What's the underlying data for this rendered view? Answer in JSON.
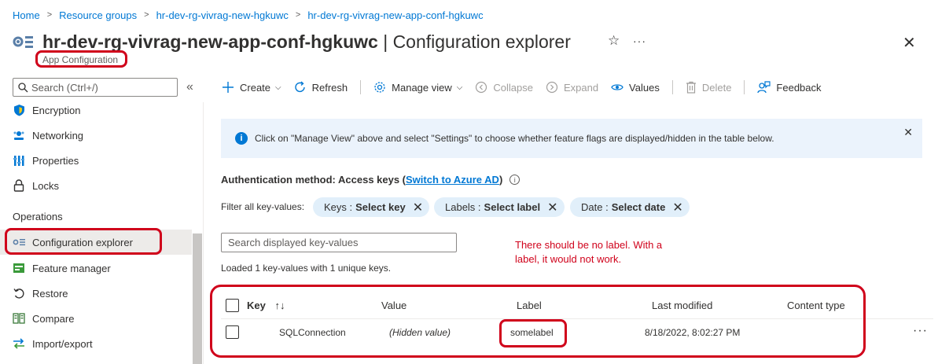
{
  "breadcrumb": [
    "Home",
    "Resource groups",
    "hr-dev-rg-vivrag-new-hgkuwc",
    "hr-dev-rg-vivrag-new-app-conf-hgkuwc"
  ],
  "header": {
    "resource_name": "hr-dev-rg-vivrag-new-app-conf-hgkuwc",
    "page_title": " | Configuration explorer",
    "subtitle": "App Configuration",
    "more": "···",
    "close": "✕",
    "star": "☆"
  },
  "sidebar": {
    "search_placeholder": "Search (Ctrl+/)",
    "collapse": "«",
    "items": [
      {
        "label": "Encryption",
        "icon": "shield-icon"
      },
      {
        "label": "Networking",
        "icon": "network-icon"
      },
      {
        "label": "Properties",
        "icon": "properties-icon"
      },
      {
        "label": "Locks",
        "icon": "lock-icon"
      }
    ],
    "section": "Operations",
    "operations": [
      {
        "label": "Configuration explorer",
        "icon": "config-explorer-icon",
        "active": true
      },
      {
        "label": "Feature manager",
        "icon": "feature-manager-icon"
      },
      {
        "label": "Restore",
        "icon": "restore-icon"
      },
      {
        "label": "Compare",
        "icon": "compare-icon"
      },
      {
        "label": "Import/export",
        "icon": "import-export-icon"
      }
    ]
  },
  "toolbar": {
    "create": "Create",
    "refresh": "Refresh",
    "manage_view": "Manage view",
    "collapse": "Collapse",
    "expand": "Expand",
    "values": "Values",
    "delete": "Delete",
    "feedback": "Feedback"
  },
  "banner": {
    "text": "Click on \"Manage View\" above and select \"Settings\" to choose whether feature flags are displayed/hidden in the table below."
  },
  "auth": {
    "label": "Authentication method: Access keys (",
    "link": "Switch to Azure AD",
    "close_paren": ")"
  },
  "filters": {
    "label": "Filter all key-values:",
    "pills": [
      {
        "prefix": "Keys :",
        "value": "Select key"
      },
      {
        "prefix": "Labels :",
        "value": "Select label"
      },
      {
        "prefix": "Date :",
        "value": "Select date"
      }
    ]
  },
  "search_kv_placeholder": "Search displayed key-values",
  "annotation": "There should be no label. With a label, it would not work.",
  "loaded_text": "Loaded 1 key-values with 1 unique keys.",
  "table": {
    "headers": [
      "Key",
      "Value",
      "Label",
      "Last modified",
      "Content type"
    ],
    "sort_icon": "↑↓",
    "rows": [
      {
        "key": "SQLConnection",
        "value": "(Hidden value)",
        "label": "somelabel",
        "last_modified": "8/18/2022, 8:02:27 PM",
        "content_type": ""
      }
    ],
    "row_more": "···"
  },
  "colors": {
    "accent": "#0078d4",
    "annotation_red": "#d0021b",
    "banner_bg": "#ebf3fc",
    "pill_bg": "#e1effa"
  }
}
